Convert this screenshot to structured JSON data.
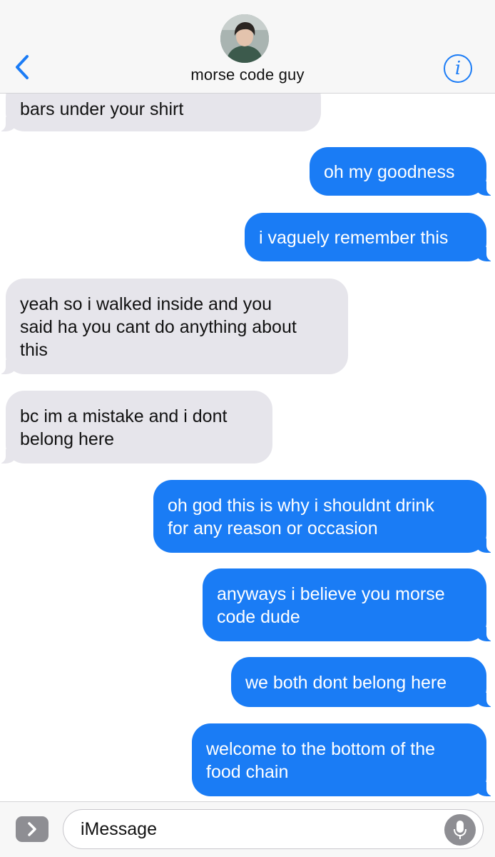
{
  "header": {
    "contact_name": "morse code guy",
    "info_glyph": "i",
    "back_icon": "chevron-left-icon",
    "accent_color": "#1b7cf6"
  },
  "messages": [
    {
      "from": "contact",
      "text": "bars under your shirt"
    },
    {
      "from": "me",
      "text": "oh my goodness"
    },
    {
      "from": "me",
      "text": "i vaguely remember this"
    },
    {
      "from": "contact",
      "text": "yeah so i walked inside and you\nsaid ha you cant do anything about\nthis"
    },
    {
      "from": "contact",
      "text": "bc im a mistake and i dont\nbelong here"
    },
    {
      "from": "me",
      "text": "oh god this is why i shouldnt drink\nfor any reason or occasion"
    },
    {
      "from": "me",
      "text": "anyways i believe you morse\ncode dude"
    },
    {
      "from": "me",
      "text": "we both dont belong here"
    },
    {
      "from": "me",
      "text": "welcome to the bottom of the\nfood chain"
    }
  ],
  "colors": {
    "sent_bubble": "#1a7cf5",
    "received_bubble": "#e6e5eb"
  },
  "input": {
    "placeholder": "iMessage",
    "apps_icon": "chevron-right-icon",
    "mic_icon": "microphone-icon"
  }
}
